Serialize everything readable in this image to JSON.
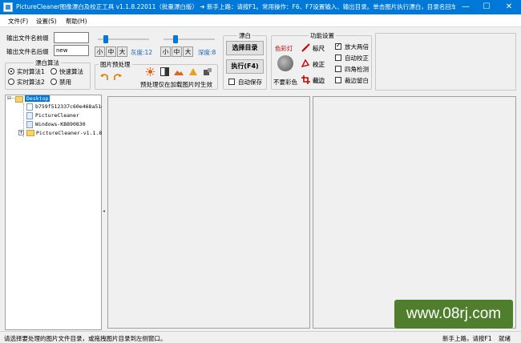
{
  "window": {
    "title": "PictureCleaner图像漂白及校正工具 v1.1.8.22011（批量漂白版）  ➜ 新手上路：请按F1。常用操作：F6、F7设置输入、输出目录。单击图片执行漂白，目录名回车…",
    "minimize": "—",
    "maximize": "☐",
    "close": "✕"
  },
  "menu": {
    "items": [
      "文件(F)",
      "设置(S)",
      "帮助(H)"
    ]
  },
  "naming": {
    "prefix_label": "输出文件名前缀",
    "prefix_value": "",
    "suffix_label": "输出文件名后缀",
    "suffix_value": "new"
  },
  "algorithm": {
    "title": "漂白算法",
    "options": [
      "实时算法1",
      "快速算法",
      "实时算法2",
      "禁用"
    ],
    "selected": "实时算法1"
  },
  "brightness": {
    "buttons": [
      "小",
      "中",
      "大"
    ],
    "label": "灰度:12",
    "level": 0.12
  },
  "depth": {
    "buttons": [
      "小",
      "中",
      "大"
    ],
    "label": "深度:8",
    "level": 0.2
  },
  "preprocess": {
    "title": "图片预处理",
    "note": "预处理仅在加载图片时生效"
  },
  "bleach": {
    "title": "漂白",
    "select_dir": "选择目录",
    "execute": "执行(F4)",
    "autosave_label": "自动保存",
    "autosave": false
  },
  "features": {
    "title": "功能设置",
    "color_lamp": "色彩灯",
    "no_color": "不要彩色",
    "ruler": "标尺",
    "correct": "校正",
    "crop": "裁边",
    "checks": [
      {
        "label": "放大两倍",
        "checked": true
      },
      {
        "label": "自动校正",
        "checked": false
      },
      {
        "label": "四角检测",
        "checked": false
      },
      {
        "label": "裁边留白",
        "checked": false
      }
    ]
  },
  "tree": {
    "root": "Desktop",
    "children": [
      "b759f512337c60e468a51e",
      "PictureCleaner",
      "Windows-KB890830",
      "PictureCleaner-v1.1.8."
    ]
  },
  "status": {
    "left": "请选择要处理的图片文件目录，或拖拽图片目录到左侧窗口。",
    "right1": "新手上路，请按F1",
    "right2": "就绪"
  },
  "watermark": "www.08rj.com",
  "colors": {
    "accent": "#0078d7",
    "watermark_bg": "#4f7f2c"
  }
}
